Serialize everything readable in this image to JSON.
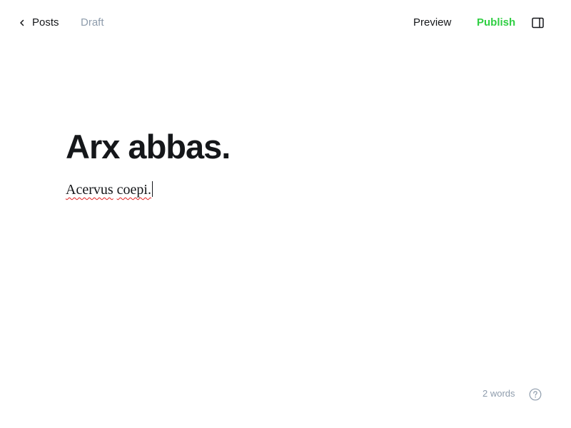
{
  "topbar": {
    "back_label": "Posts",
    "back_icon": "chevron-left-icon",
    "status": "Draft",
    "preview_label": "Preview",
    "publish_label": "Publish",
    "sidebar_icon": "sidebar-panel-icon"
  },
  "editor": {
    "title": "Arx abbas.",
    "body_words": [
      "Acervus",
      "coepi."
    ]
  },
  "footer": {
    "word_count": "2 words",
    "help_icon": "question-mark-icon"
  },
  "colors": {
    "text": "#15171a",
    "muted": "#8e9cac",
    "publish": "#30cf43",
    "spellcheck": "#e02020"
  }
}
